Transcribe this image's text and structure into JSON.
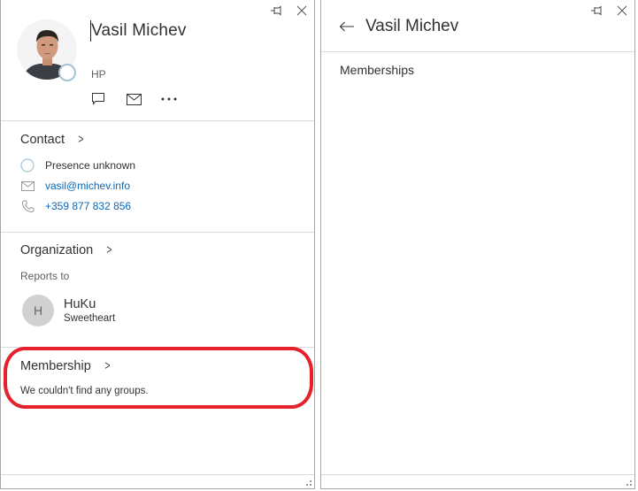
{
  "card_window": {
    "controls": {
      "pin": "pin-icon",
      "close": "close-icon"
    },
    "person": {
      "name": "Vasil Michev",
      "company": "HP",
      "presence": "unknown"
    },
    "actions": [
      {
        "icon": "chat-icon",
        "label": "Chat"
      },
      {
        "icon": "mail-icon",
        "label": "Email"
      },
      {
        "icon": "more-icon",
        "label": "More"
      }
    ],
    "contact": {
      "title": "Contact",
      "presence_text": "Presence unknown",
      "email": "vasil@michev.info",
      "phone": "+359 877 832 856"
    },
    "organization": {
      "title": "Organization",
      "reports_to_label": "Reports to",
      "manager": {
        "initial": "H",
        "name": "HuKu",
        "title": "Sweetheart"
      }
    },
    "membership": {
      "title": "Membership",
      "empty_text": "We couldn't find any groups."
    },
    "annotation": {
      "color": "#e5212c",
      "target": "membership"
    }
  },
  "memberships_window": {
    "controls": {
      "pin": "pin-icon",
      "close": "close-icon"
    },
    "header_title": "Vasil Michev",
    "section_label": "Memberships"
  },
  "colors": {
    "link": "#0a67b5",
    "presence_ring": "#a3c4d6",
    "divider": "#dadada",
    "window_border": "#a6a6a6"
  }
}
